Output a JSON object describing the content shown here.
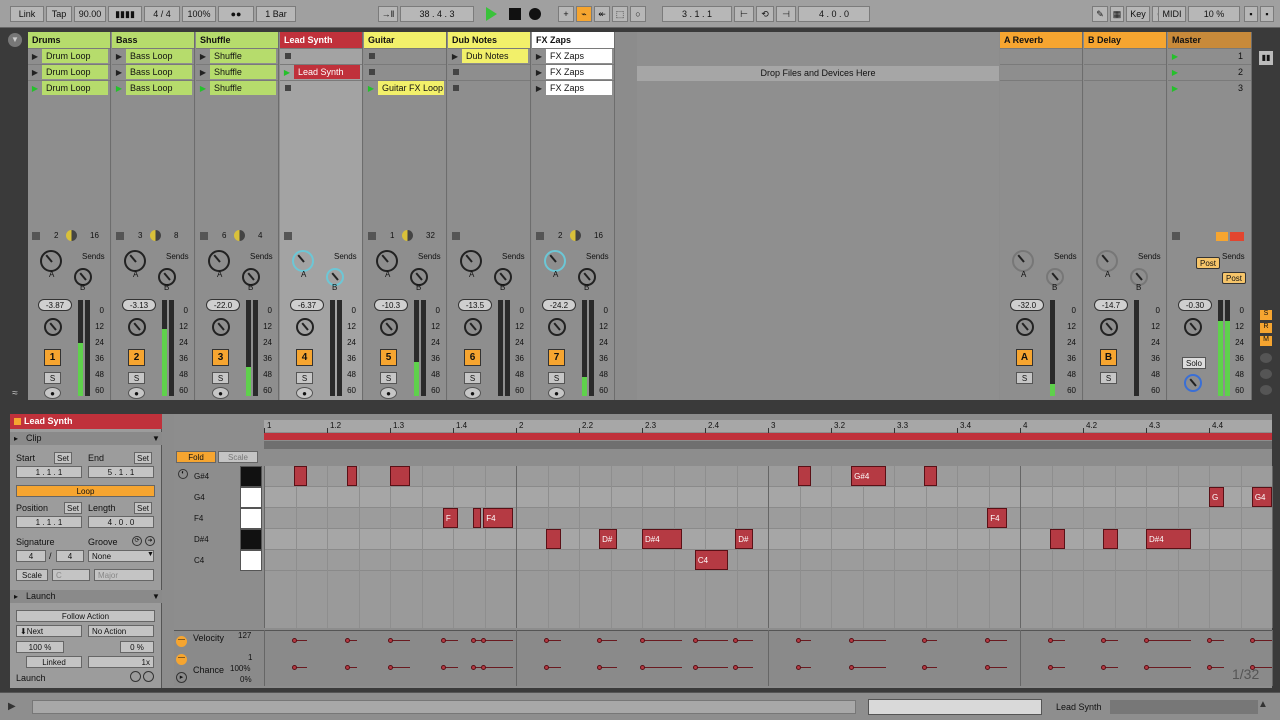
{
  "transport": {
    "link": "Link",
    "tap": "Tap",
    "tempo": "90.00",
    "meter_icon": "metronome-bars-icon",
    "signature": "4 / 4",
    "zoom": "100%",
    "dots": "●●",
    "quantize": "1 Bar",
    "position": "38 .  4 .  3",
    "loop_start": "3 .  1 .  1",
    "loop_length": "4 .  0 .  0",
    "key": "Key",
    "midi": "MIDI",
    "cpu": "10 %"
  },
  "tracks": [
    {
      "name": "Drums",
      "color": "#b6dc6c",
      "clips": [
        "Drum Loop",
        "Drum Loop",
        "Drum Loop"
      ],
      "io_a": "2",
      "io_b": "16",
      "vol": "-3.87",
      "num": "1",
      "meter": 0.55
    },
    {
      "name": "Bass",
      "color": "#b6dc6c",
      "clips": [
        "Bass Loop",
        "Bass Loop",
        "Bass Loop"
      ],
      "io_a": "3",
      "io_b": "8",
      "vol": "-3.13",
      "num": "2",
      "meter": 0.7
    },
    {
      "name": "Shuffle",
      "color": "#b6dc6c",
      "clips": [
        "Shuffle",
        "Shuffle",
        "Shuffle"
      ],
      "io_a": "6",
      "io_b": "4",
      "vol": "-22.0",
      "num": "3",
      "meter": 0.3
    },
    {
      "name": "Lead Synth",
      "color": "#c0313b",
      "clips": [
        "",
        "Lead Synth",
        ""
      ],
      "io_a": "",
      "io_b": "",
      "vol": "-6.37",
      "num": "4",
      "meter": 0.0
    },
    {
      "name": "Guitar",
      "color": "#f2f06a",
      "clips": [
        "",
        "",
        "Guitar FX Loop"
      ],
      "io_a": "1",
      "io_b": "32",
      "vol": "-10.3",
      "num": "5",
      "meter": 0.35
    },
    {
      "name": "Dub Notes",
      "color": "#f2f06a",
      "clips": [
        "Dub Notes",
        "",
        ""
      ],
      "io_a": "",
      "io_b": "",
      "vol": "-13.5",
      "num": "6",
      "meter": 0.0
    },
    {
      "name": "FX Zaps",
      "color": "#ffffff",
      "clips": [
        "FX Zaps",
        "FX Zaps",
        "FX Zaps"
      ],
      "io_a": "2",
      "io_b": "16",
      "vol": "-24.2",
      "num": "7",
      "meter": 0.2
    }
  ],
  "drop_hint": "Drop Files and Devices Here",
  "returns": [
    {
      "name": "A Reverb",
      "vol": "-32.0",
      "num": "A"
    },
    {
      "name": "B Delay",
      "vol": "-14.7",
      "num": "B"
    }
  ],
  "master": {
    "name": "Master",
    "vol": "-0.30",
    "scenes": [
      "1",
      "2",
      "3"
    ],
    "post": "Post",
    "solo": "Solo"
  },
  "sends_label": "Sends",
  "solo_label": "S",
  "knob_a": "A",
  "knob_b": "B",
  "db_scale": [
    "0",
    "12",
    "24",
    "36",
    "48",
    "60"
  ],
  "clip_panel": {
    "title": "Lead Synth",
    "section": "Clip",
    "start": "Start",
    "end": "End",
    "set": "Set",
    "start_val": "1 .  1 .  1",
    "end_val": "5 .  1 .  1",
    "loop": "Loop",
    "position": "Position",
    "length": "Length",
    "pos_val": "1 .  1 .  1",
    "len_val": "4 .  0 .  0",
    "signature": "Signature",
    "groove": "Groove",
    "sig_num": "4",
    "sig_den": "4",
    "groove_val": "None",
    "scale": "Scale",
    "scale_root": "C",
    "scale_type": "Major",
    "launch": "Launch",
    "follow": "Follow Action",
    "next": "Next",
    "no_action": "No Action",
    "pct1": "100 %",
    "pct2": "0 %",
    "linked": "Linked",
    "mult": "1x",
    "launch2": "Launch"
  },
  "piano": {
    "fold": "Fold",
    "scale": "Scale",
    "rows": [
      "G#4",
      "G4",
      "F4",
      "D#4",
      "C4"
    ],
    "ruler": [
      "1",
      "1.2",
      "1.3",
      "1.4",
      "2",
      "2.2",
      "2.3",
      "2.4",
      "3",
      "3.2",
      "3.3",
      "3.4",
      "4",
      "4.2",
      "4.3",
      "4.4"
    ],
    "velocity": "Velocity",
    "v127": "127",
    "v1": "1",
    "chance": "Chance",
    "c100": "100%",
    "c0": "0%",
    "grid": "1/32"
  },
  "notes": [
    {
      "row": 0,
      "start": 0.12,
      "len": 0.05,
      "label": ""
    },
    {
      "row": 0,
      "start": 0.33,
      "len": 0.04,
      "label": ""
    },
    {
      "row": 0,
      "start": 0.5,
      "len": 0.08,
      "label": ""
    },
    {
      "row": 0,
      "start": 2.12,
      "len": 0.05,
      "label": ""
    },
    {
      "row": 0,
      "start": 2.33,
      "len": 0.14,
      "label": "G#4"
    },
    {
      "row": 0,
      "start": 2.62,
      "len": 0.05,
      "label": ""
    },
    {
      "row": 1,
      "start": 3.75,
      "len": 0.06,
      "label": "G"
    },
    {
      "row": 1,
      "start": 3.92,
      "len": 0.08,
      "label": "G4"
    },
    {
      "row": 2,
      "start": 0.71,
      "len": 0.06,
      "label": "F"
    },
    {
      "row": 2,
      "start": 0.83,
      "len": 0.03,
      "label": ""
    },
    {
      "row": 2,
      "start": 0.87,
      "len": 0.12,
      "label": "F4"
    },
    {
      "row": 2,
      "start": 2.87,
      "len": 0.08,
      "label": "F4"
    },
    {
      "row": 3,
      "start": 1.12,
      "len": 0.06,
      "label": ""
    },
    {
      "row": 3,
      "start": 1.33,
      "len": 0.07,
      "label": "D#"
    },
    {
      "row": 3,
      "start": 1.5,
      "len": 0.16,
      "label": "D#4"
    },
    {
      "row": 3,
      "start": 1.87,
      "len": 0.07,
      "label": "D#"
    },
    {
      "row": 3,
      "start": 3.12,
      "len": 0.06,
      "label": ""
    },
    {
      "row": 3,
      "start": 3.33,
      "len": 0.06,
      "label": ""
    },
    {
      "row": 3,
      "start": 3.5,
      "len": 0.18,
      "label": "D#4"
    },
    {
      "row": 4,
      "start": 1.71,
      "len": 0.13,
      "label": "C4"
    }
  ],
  "status": {
    "track": "Lead Synth"
  }
}
